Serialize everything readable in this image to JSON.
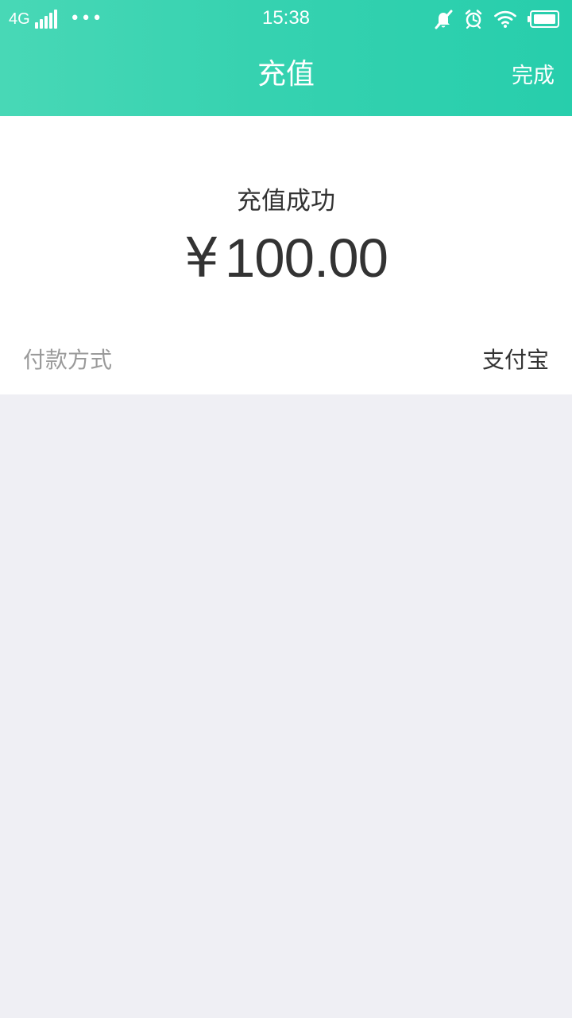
{
  "status_bar": {
    "network": "4G",
    "more_indicator": "•••",
    "time": "15:38",
    "icons": [
      "signal-icon",
      "more-icon",
      "silent-icon",
      "alarm-icon",
      "wifi-icon",
      "battery-icon"
    ]
  },
  "header": {
    "title": "充值",
    "done_label": "完成"
  },
  "result": {
    "success_text": "充值成功",
    "currency_symbol": "¥",
    "amount_value": "100.00"
  },
  "payment": {
    "label": "付款方式",
    "method": "支付宝"
  },
  "colors": {
    "accent_start": "#48d8b6",
    "accent_end": "#27ceac",
    "page_background": "#efeff4",
    "card_background": "#ffffff",
    "primary_text": "#333333",
    "secondary_text": "#9a9a9a"
  }
}
